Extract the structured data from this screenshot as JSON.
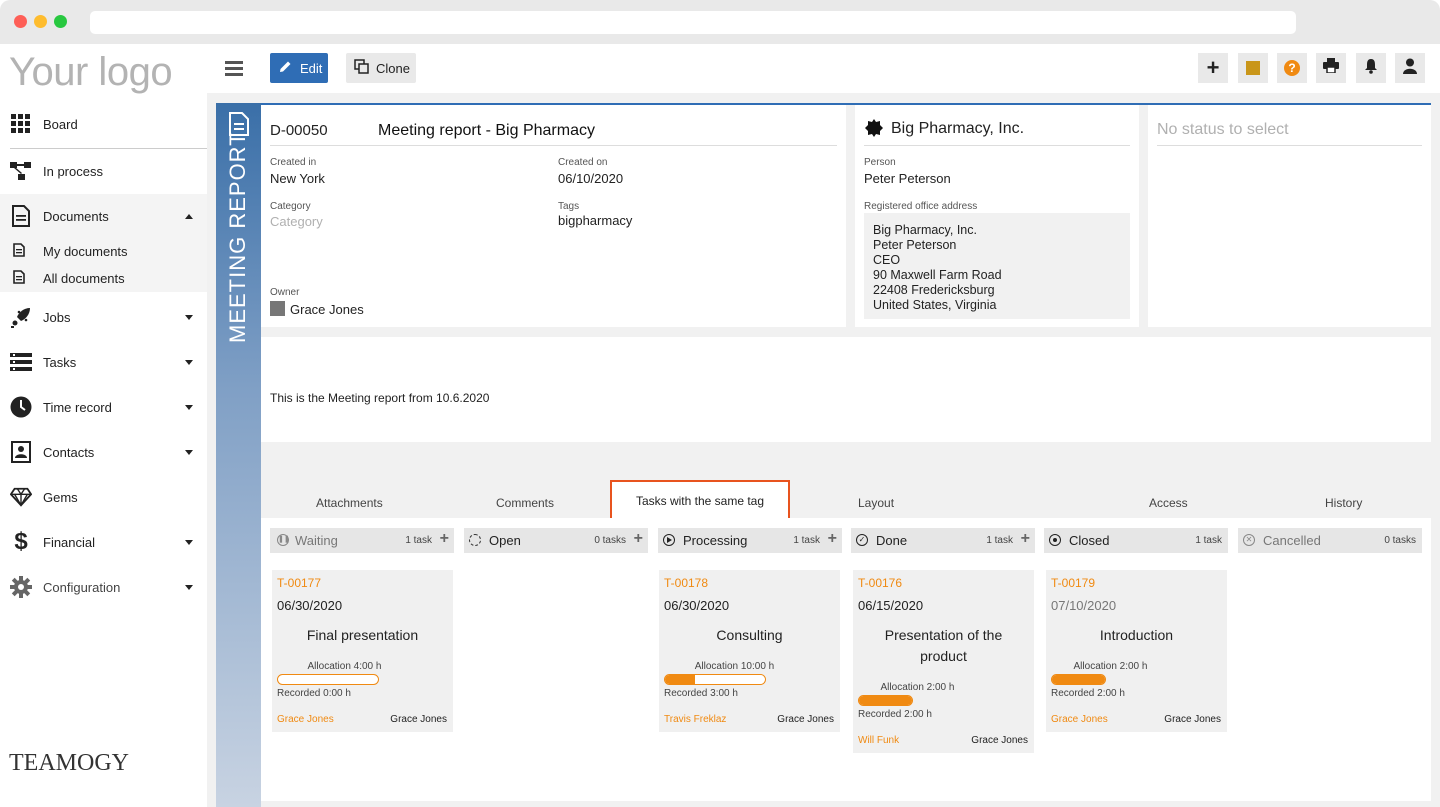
{
  "logo": {
    "text": "Your logo",
    "footer": "TEAMOGY"
  },
  "sidebar": {
    "items": [
      {
        "label": "Board",
        "icon": "grid-icon"
      },
      {
        "label": "In process",
        "icon": "workflow-icon"
      },
      {
        "label": "Documents",
        "icon": "document-icon"
      },
      {
        "label": "Jobs",
        "icon": "rocket-icon"
      },
      {
        "label": "Tasks",
        "icon": "tasks-icon"
      },
      {
        "label": "Time record",
        "icon": "clock-icon"
      },
      {
        "label": "Contacts",
        "icon": "contact-card-icon"
      },
      {
        "label": "Gems",
        "icon": "gem-icon"
      },
      {
        "label": "Financial",
        "icon": "dollar-icon"
      },
      {
        "label": "Configuration",
        "icon": "gear-icon"
      }
    ],
    "sub": [
      {
        "label": "My documents"
      },
      {
        "label": "All documents"
      }
    ]
  },
  "toolbar": {
    "edit_label": "Edit",
    "clone_label": "Clone"
  },
  "doc": {
    "vertical_label": "MEETING REPORT",
    "id": "D-00050",
    "title": "Meeting report - Big Pharmacy",
    "created_in_label": "Created in",
    "created_in": "New York",
    "created_on_label": "Created on",
    "created_on": "06/10/2020",
    "category_label": "Category",
    "category_placeholder": "Category",
    "tags_label": "Tags",
    "tags": "bigpharmacy",
    "owner_label": "Owner",
    "owner": "Grace Jones",
    "body": "This is the Meeting report from 10.6.2020"
  },
  "company": {
    "name": "Big Pharmacy, Inc.",
    "person_label": "Person",
    "person": "Peter Peterson",
    "address_label": "Registered office address",
    "address": [
      "Big Pharmacy, Inc.",
      "Peter Peterson",
      "CEO",
      "90 Maxwell Farm Road",
      "22408 Fredericksburg",
      "United States, Virginia"
    ]
  },
  "status": {
    "placeholder": "No status to select"
  },
  "tabs": [
    "Attachments",
    "Comments",
    "Tasks with the same tag",
    "Layout",
    "Access",
    "History"
  ],
  "active_tab": "Tasks with the same tag",
  "columns": [
    {
      "name": "Waiting",
      "count": "1 task",
      "muted": true
    },
    {
      "name": "Open",
      "count": "0 tasks",
      "muted": false
    },
    {
      "name": "Processing",
      "count": "1 task",
      "muted": false
    },
    {
      "name": "Done",
      "count": "1 task",
      "muted": false
    },
    {
      "name": "Closed",
      "count": "1 task",
      "muted": false
    },
    {
      "name": "Cancelled",
      "count": "0 tasks",
      "muted": true
    }
  ],
  "tasks": [
    {
      "id": "T-00177",
      "date": "06/30/2020",
      "title": "Final presentation",
      "allocation": "Allocation 4:00 h",
      "recorded": "Recorded 0:00 h",
      "progress": 0,
      "assignee": "Grace Jones",
      "owner": "Grace Jones"
    },
    {
      "id": "T-00178",
      "date": "06/30/2020",
      "title": "Consulting",
      "allocation": "Allocation 10:00 h",
      "recorded": "Recorded 3:00 h",
      "progress": 0.3,
      "assignee": "Travis Freklaz",
      "owner": "Grace Jones"
    },
    {
      "id": "T-00176",
      "date": "06/15/2020",
      "title": "Presentation of the product",
      "allocation": "Allocation 2:00 h",
      "recorded": "Recorded 2:00 h",
      "progress": 1,
      "assignee": "Will Funk",
      "owner": "Grace Jones"
    },
    {
      "id": "T-00179",
      "date": "07/10/2020",
      "title": "Introduction",
      "allocation": "Allocation 2:00 h",
      "recorded": "Recorded 2:00 h",
      "progress": 1,
      "assignee": "Grace Jones",
      "owner": "Grace Jones"
    }
  ],
  "colors": {
    "accent": "#f08a12",
    "primary": "#2f6db5",
    "highlight": "#e8531e"
  }
}
